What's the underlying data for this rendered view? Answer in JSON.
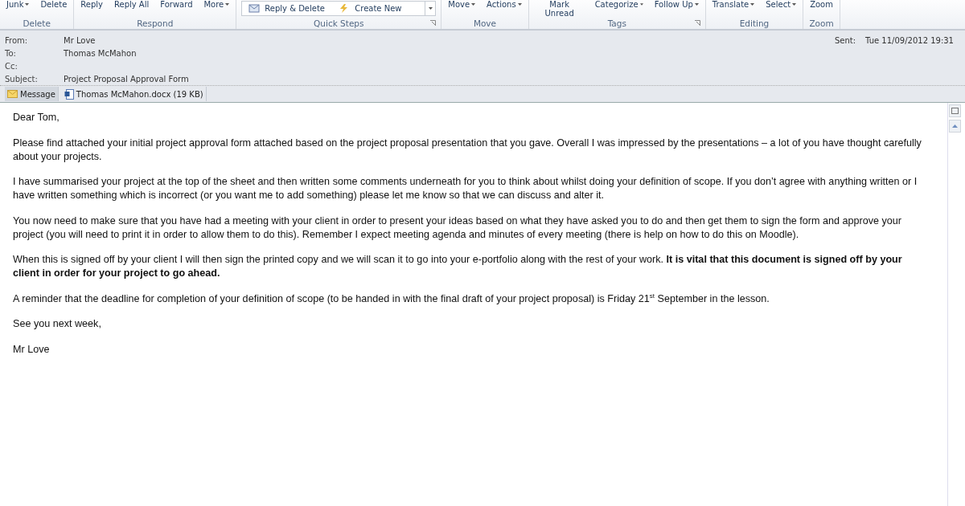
{
  "ribbon": {
    "groups": [
      {
        "label": "Delete",
        "buttons": [
          {
            "label": "Junk",
            "dropdown": true
          },
          {
            "label": "Delete",
            "dropdown": false
          }
        ]
      },
      {
        "label": "Respond",
        "buttons": [
          {
            "label": "Reply",
            "dropdown": false
          },
          {
            "label": "Reply All",
            "dropdown": false
          },
          {
            "label": "Forward",
            "dropdown": false
          },
          {
            "label": "More",
            "dropdown": true
          }
        ]
      },
      {
        "label": "Quick Steps",
        "launcher": true,
        "quick_steps": [
          "Reply & Delete",
          "Create New"
        ]
      },
      {
        "label": "Move",
        "launcher": false,
        "buttons": [
          {
            "label": "Move",
            "dropdown": true
          },
          {
            "label": "Actions",
            "dropdown": true
          }
        ]
      },
      {
        "label": "Tags",
        "launcher": true,
        "buttons": [
          {
            "label": "Mark Unread",
            "dropdown": false
          },
          {
            "label": "Categorize",
            "dropdown": true
          },
          {
            "label": "Follow Up",
            "dropdown": true
          }
        ]
      },
      {
        "label": "Editing",
        "buttons": [
          {
            "label": "Translate",
            "dropdown": true
          },
          {
            "label": "Select",
            "dropdown": true
          }
        ]
      },
      {
        "label": "Zoom",
        "buttons": [
          {
            "label": "Zoom",
            "dropdown": false
          }
        ]
      }
    ]
  },
  "header": {
    "fields": [
      {
        "label": "From:",
        "value": "Mr Love"
      },
      {
        "label": "To:",
        "value": "Thomas McMahon"
      },
      {
        "label": "Cc:"
      },
      {
        "label": "Subject:",
        "value": "Project Proposal Approval Form"
      }
    ],
    "sent_label": "Sent:",
    "sent_value": "Tue 11/09/2012 19:31"
  },
  "attachments": [
    {
      "label": "Message",
      "kind": "message",
      "selected": true
    },
    {
      "label": "Thomas McMahon.docx (19 KB)",
      "kind": "document",
      "selected": false
    }
  ],
  "body": [
    "Dear Tom,",
    "Please find attached your initial project approval form attached based on the project proposal presentation that you gave. Overall I was impressed by the presentations – a lot of you have thought carefully about your projects.",
    "I have summarised your project at the top of the sheet and then written some comments underneath for you to think about whilst doing your definition of scope. If you don’t agree with anything written or I have written something which is incorrect (or you want me to add something) please let me know so that we can discuss and alter it.",
    "You now need to make sure that you have had a meeting with your client in order to present your ideas based on what they have asked you to do and then get them to sign the form and approve your project (you will need to print it in order to allow them to do this). Remember I expect meeting agenda and minutes of every meeting (there is help on how to do this on Moodle).",
    "When this is signed off by your client I will then sign the printed copy and we will scan it to go into your e-portfolio along with the rest of your work. **It is vital that this document is signed off by your client in order for your project to go ahead.**",
    "A reminder that the deadline for completion of your definition of scope (to be handed in with the final draft of your project proposal) is Friday 21$^{st}$ September in the lesson.",
    "See you next week,",
    "Mr Love"
  ]
}
